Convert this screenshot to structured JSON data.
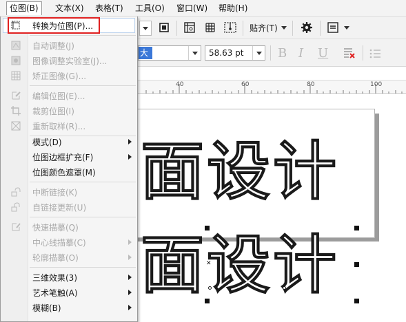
{
  "menubar": {
    "items": [
      "位图(B)",
      "文本(X)",
      "表格(T)",
      "工具(O)",
      "窗口(W)",
      "帮助(H)"
    ]
  },
  "toolbar": {
    "snap_label": "贴齐(T)",
    "font_name_partial": "大",
    "font_size": "58.63 pt"
  },
  "ruler": {
    "labels": [
      "40",
      "60",
      "80",
      "100"
    ]
  },
  "canvas": {
    "line1": "面设计",
    "line2": "面设计"
  },
  "bitmap_menu": {
    "items": [
      {
        "label": "转换为位图(P)...",
        "enabled": true,
        "submenu": false
      },
      {
        "label": "自动调整(J)",
        "enabled": false,
        "submenu": false
      },
      {
        "label": "图像调整实验室(J)...",
        "enabled": false,
        "submenu": false
      },
      {
        "label": "矫正图像(G)...",
        "enabled": false,
        "submenu": false
      },
      {
        "label": "编辑位图(E)...",
        "enabled": false,
        "submenu": false
      },
      {
        "label": "裁剪位图(I)",
        "enabled": false,
        "submenu": false
      },
      {
        "label": "重新取样(R)...",
        "enabled": false,
        "submenu": false
      },
      {
        "label": "模式(D)",
        "enabled": true,
        "submenu": true
      },
      {
        "label": "位图边框扩充(F)",
        "enabled": true,
        "submenu": true
      },
      {
        "label": "位图颜色遮罩(M)",
        "enabled": true,
        "submenu": false
      },
      {
        "label": "中断链接(K)",
        "enabled": false,
        "submenu": false
      },
      {
        "label": "自链接更新(U)",
        "enabled": false,
        "submenu": false
      },
      {
        "label": "快速描摹(Q)",
        "enabled": false,
        "submenu": false
      },
      {
        "label": "中心线描摹(C)",
        "enabled": false,
        "submenu": true
      },
      {
        "label": "轮廓描摹(O)",
        "enabled": false,
        "submenu": true
      },
      {
        "label": "三维效果(3)",
        "enabled": true,
        "submenu": true
      },
      {
        "label": "艺术笔触(A)",
        "enabled": true,
        "submenu": true
      },
      {
        "label": "模糊(B)",
        "enabled": true,
        "submenu": true
      }
    ]
  },
  "colors": {
    "highlight_box": "#e02020",
    "font_selection": "#3b78d8"
  }
}
